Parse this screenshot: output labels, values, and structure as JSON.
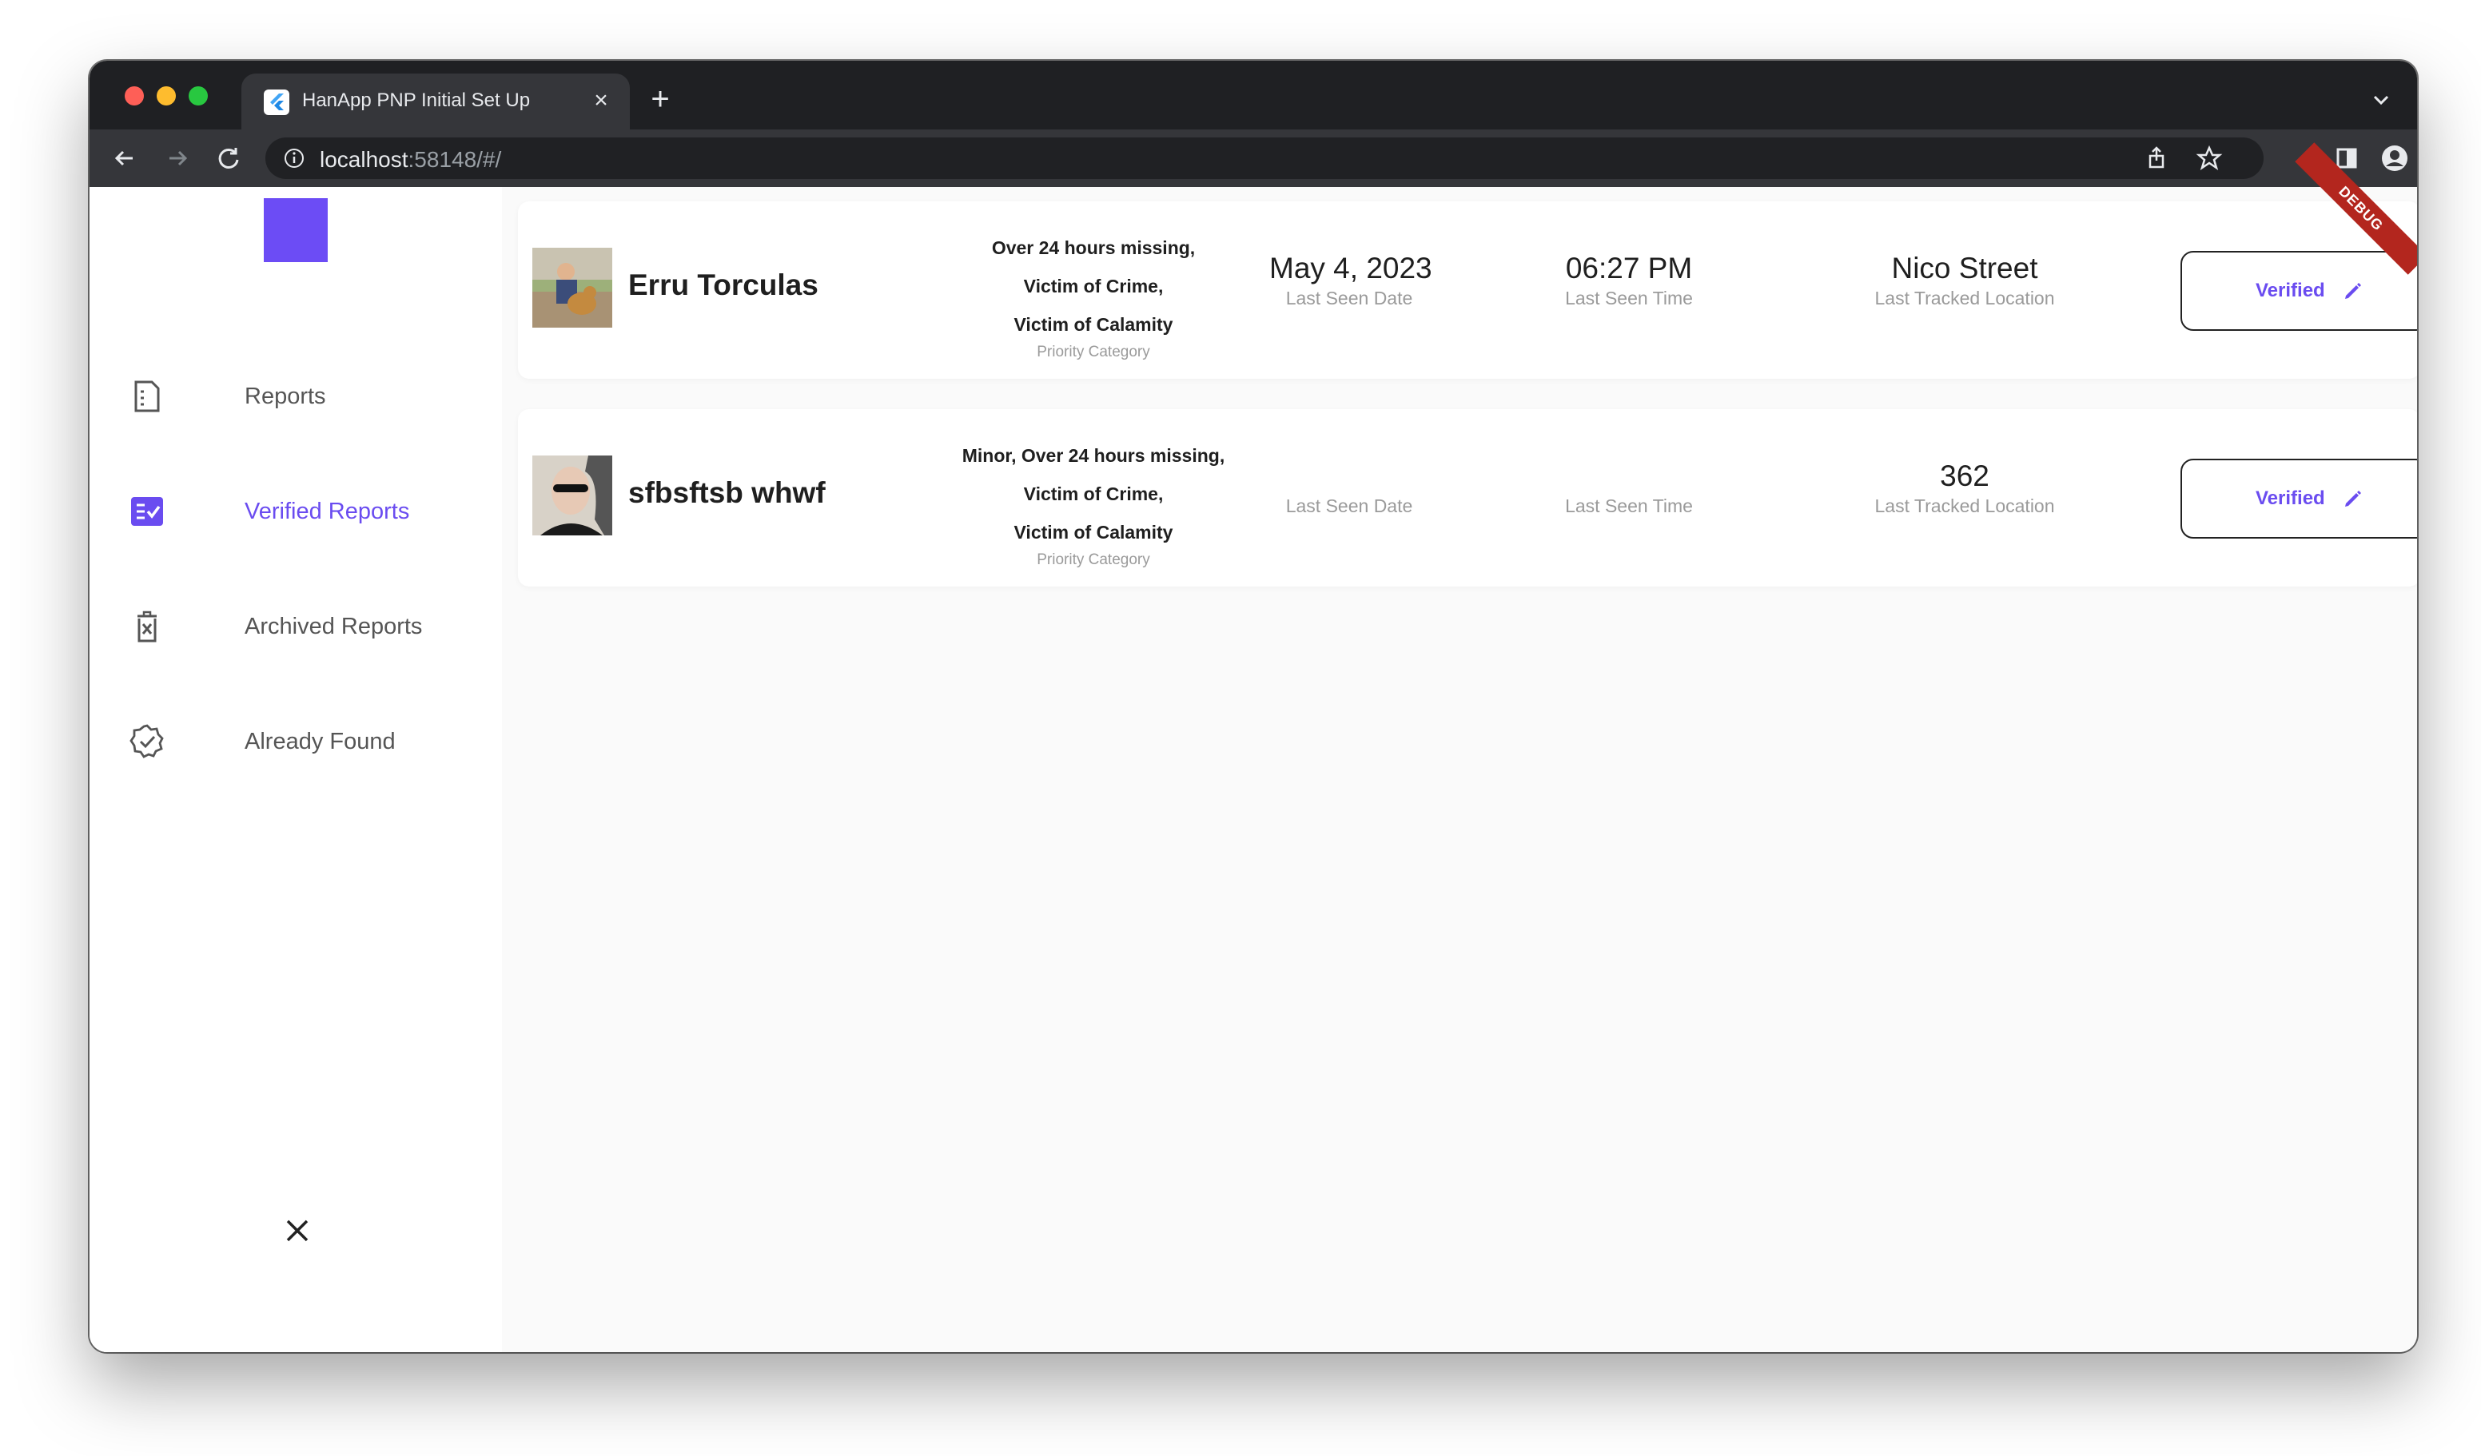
{
  "browser": {
    "tab_title": "HanApp PNP Initial Set Up",
    "url_host": "localhost",
    "url_rest": ":58148/#/"
  },
  "sidebar": {
    "items": [
      {
        "label": "Reports",
        "icon": "document-icon",
        "active": false
      },
      {
        "label": "Verified Reports",
        "icon": "checklist-icon",
        "active": true
      },
      {
        "label": "Archived Reports",
        "icon": "trash-x-icon",
        "active": false
      },
      {
        "label": "Already Found",
        "icon": "verified-badge-icon",
        "active": false
      }
    ],
    "accent_color": "#6a4cf0"
  },
  "debug_banner": "DEBUG",
  "reports": [
    {
      "name": "Erru Torculas",
      "priority_lines": [
        "Over 24 hours missing,",
        "Victim of Crime,",
        "Victim of Calamity"
      ],
      "priority_label": "Priority Category",
      "last_seen_date": "May 4, 2023",
      "last_seen_date_label": "Last Seen Date",
      "last_seen_time": "06:27 PM",
      "last_seen_time_label": "Last Seen Time",
      "last_location": "Nico Street",
      "last_location_label": "Last Tracked Location",
      "status_button": "Verified"
    },
    {
      "name": "sfbsftsb whwf",
      "priority_lines": [
        "Minor, Over 24 hours missing,",
        "Victim of Crime,",
        "Victim of Calamity"
      ],
      "priority_label": "Priority Category",
      "last_seen_date": "",
      "last_seen_date_label": "Last Seen Date",
      "last_seen_time": "",
      "last_seen_time_label": "Last Seen Time",
      "last_location": "362",
      "last_location_label": "Last Tracked Location",
      "status_button": "Verified"
    }
  ]
}
